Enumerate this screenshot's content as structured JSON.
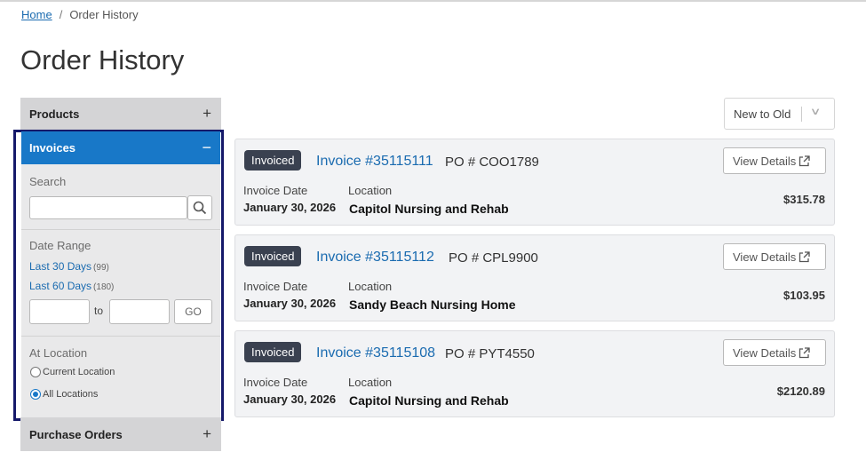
{
  "breadcrumb": {
    "home": "Home",
    "separator": "/",
    "current": "Order History"
  },
  "page_title": "Order History",
  "sidebar": {
    "products_label": "Products",
    "products_toggle": "+",
    "invoices_label": "Invoices",
    "invoices_toggle": "−",
    "search_label": "Search",
    "date_range_label": "Date Range",
    "range_30_label": "Last 30 Days",
    "range_30_count": "(99)",
    "range_60_label": "Last 60 Days",
    "range_60_count": "(180)",
    "to_label": "to",
    "go_label": "GO",
    "location_label": "At Location",
    "current_location_label": "Current Location",
    "all_locations_label": "All Locations",
    "selected_location": "All Locations",
    "purchase_orders_label": "Purchase Orders",
    "purchase_orders_toggle": "+"
  },
  "sort": {
    "selected": "New to Old"
  },
  "labels": {
    "invoice_date": "Invoice Date",
    "location": "Location",
    "view_details": "View Details"
  },
  "invoices": [
    {
      "status": "Invoiced",
      "number": "Invoice #35115111",
      "po": "PO # COO1789",
      "date": "January 30, 2026",
      "location": "Capitol Nursing and Rehab",
      "amount": "$315.78"
    },
    {
      "status": "Invoiced",
      "number": "Invoice #35115112",
      "po": "PO # CPL9900",
      "date": "January 30, 2026",
      "location": "Sandy Beach Nursing Home",
      "amount": "$103.95"
    },
    {
      "status": "Invoiced",
      "number": "Invoice #35115108",
      "po": "PO # PYT4550",
      "date": "January 30, 2026",
      "location": "Capitol Nursing and Rehab",
      "amount": "$2120.89"
    }
  ],
  "colors": {
    "accent": "#1878c8",
    "link": "#1a6bb0",
    "badge": "#3a4150",
    "focus_outline": "#15196a"
  },
  "icons": [
    "search-icon",
    "external-link-icon",
    "chevron-down-icon",
    "plus-icon",
    "minus-icon"
  ]
}
